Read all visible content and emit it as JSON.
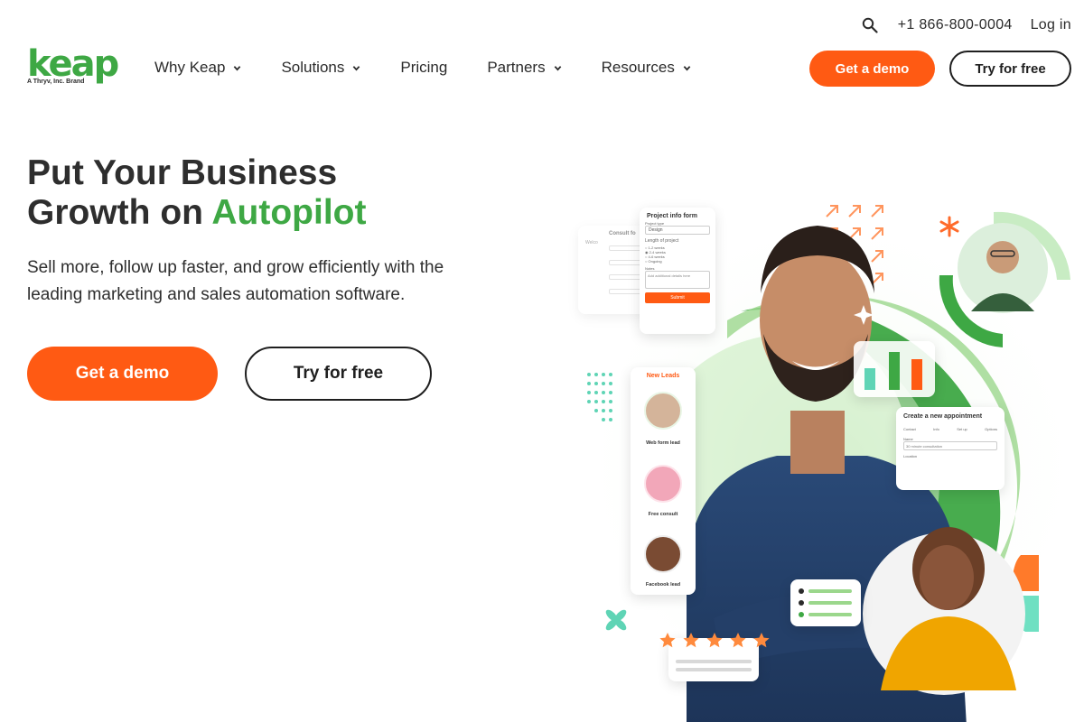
{
  "utility": {
    "search_icon": "search-icon",
    "phone": "+1 866-800-0004",
    "login": "Log in"
  },
  "logo": {
    "word": "keap",
    "tagline": "A Thryv, Inc. Brand"
  },
  "nav": {
    "items": [
      {
        "label": "Why Keap",
        "dropdown": true
      },
      {
        "label": "Solutions",
        "dropdown": true
      },
      {
        "label": "Pricing",
        "dropdown": false
      },
      {
        "label": "Partners",
        "dropdown": true
      },
      {
        "label": "Resources",
        "dropdown": true
      }
    ],
    "demo_label": "Get a demo",
    "try_label": "Try for free"
  },
  "hero": {
    "title_line1": "Put Your Business",
    "title_line2_plain": "Growth on ",
    "title_line2_accent": "Autopilot",
    "subtitle": "Sell more, follow up faster, and grow efficiently with the leading marketing and sales automation software.",
    "demo_label": "Get a demo",
    "try_label": "Try for free"
  },
  "illustration": {
    "project_form": {
      "title": "Project info form",
      "field1_label": "Project type",
      "field1_value": "Design",
      "length_label": "Length of project",
      "options": [
        "1-2 weeks",
        "2-4 weeks",
        "4-6 weeks",
        "Ongoing"
      ],
      "notes_label": "Notes",
      "notes_placeholder": "Add additional details here",
      "submit": "Submit"
    },
    "consult_form": {
      "title": "Consult fo",
      "welcome": "Welco"
    },
    "leads": {
      "title": "New Leads",
      "items": [
        "Web form lead",
        "Free consult",
        "Facebook lead"
      ]
    },
    "appointment": {
      "title": "Create a new appointment",
      "steps": [
        "Contact",
        "Info",
        "Set up",
        "Options"
      ],
      "name_label": "Name",
      "name_value": "30 minute consultation",
      "location_label": "Location"
    },
    "colors": {
      "green": "#3ea844",
      "orange": "#ff5a13",
      "teal": "#5fd4b5"
    }
  }
}
